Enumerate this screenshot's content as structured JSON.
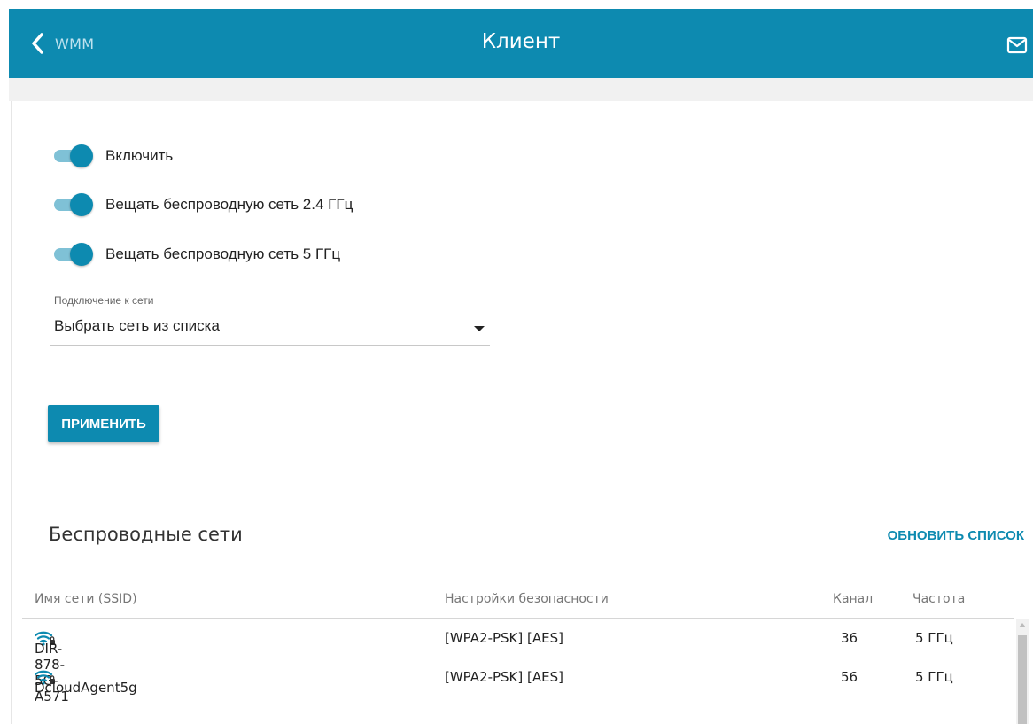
{
  "header": {
    "back_label": "WMM",
    "title": "Клиент",
    "icons": {
      "back": "chevron-left-icon",
      "mail": "mail-icon"
    }
  },
  "toggles": [
    {
      "label": "Включить",
      "on": true
    },
    {
      "label": "Вещать беспроводную сеть 2.4 ГГц",
      "on": true
    },
    {
      "label": "Вещать беспроводную сеть 5 ГГц",
      "on": true
    }
  ],
  "connection": {
    "label": "Подключение к сети",
    "value": "Выбрать сеть из списка"
  },
  "apply_label": "ПРИМЕНИТЬ",
  "networks": {
    "title": "Беспроводные сети",
    "refresh_label": "ОБНОВИТЬ СПИСОК",
    "columns": {
      "ssid": "Имя сети (SSID)",
      "security": "Настройки безопасности",
      "channel": "Канал",
      "frequency": "Частота"
    },
    "rows": [
      {
        "ssid": "DIR-878-5G-A571",
        "security": "[WPA2-PSK] [AES]",
        "channel": "36",
        "frequency": "5 ГГц"
      },
      {
        "ssid": "DcloudAgent5g",
        "security": "[WPA2-PSK] [AES]",
        "channel": "56",
        "frequency": "5 ГГц"
      }
    ]
  },
  "colors": {
    "accent": "#0d8ab0",
    "toggle_track": "#7fc1d6"
  }
}
